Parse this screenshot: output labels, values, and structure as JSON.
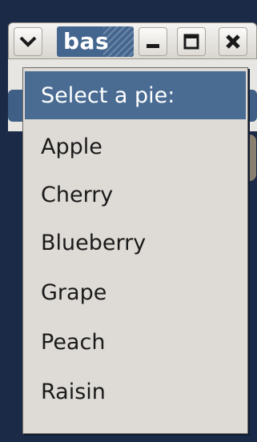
{
  "window": {
    "title": "bas"
  },
  "menu": {
    "header": "Select a pie:",
    "items": [
      "Apple",
      "Cherry",
      "Blueberry",
      "Grape",
      "Peach",
      "Raisin"
    ]
  },
  "colors": {
    "highlight": "#4a6c93",
    "menu_bg": "#dedbd6",
    "desktop_bg": "#1b2a47"
  },
  "icons": {
    "window_menu": "chevron-down-icon",
    "minimize": "minimize-icon",
    "maximize": "maximize-icon",
    "close": "close-icon"
  }
}
